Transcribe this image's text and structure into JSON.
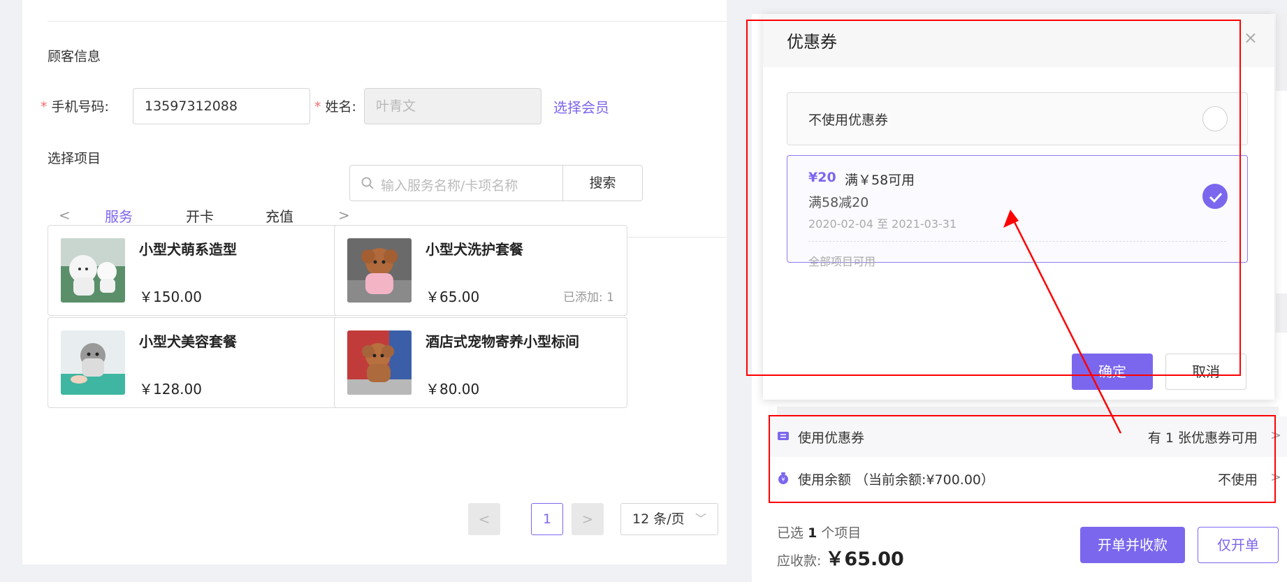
{
  "customer": {
    "section_title": "顾客信息",
    "phone_label": "手机号码:",
    "phone_value": "13597312088",
    "name_label": "姓名:",
    "name_placeholder": "叶青文",
    "select_member": "选择会员"
  },
  "project": {
    "section_title": "选择项目",
    "tab_prev": "<",
    "tab_next": ">",
    "tabs": [
      {
        "label": "服务",
        "active": true
      },
      {
        "label": "开卡",
        "active": false
      },
      {
        "label": "充值",
        "active": false
      }
    ],
    "search_placeholder": "输入服务名称/卡项名称",
    "search_button": "搜索",
    "items": [
      {
        "name": "小型犬萌系造型",
        "price": "￥150.00",
        "added": ""
      },
      {
        "name": "小型犬洗护套餐",
        "price": "￥65.00",
        "added": "已添加: 1"
      },
      {
        "name": "小型犬美容套餐",
        "price": "￥128.00",
        "added": ""
      },
      {
        "name": "酒店式宠物寄养小型标间",
        "price": "￥80.00",
        "added": ""
      }
    ]
  },
  "pagination": {
    "prev": "<",
    "current": "1",
    "next": ">",
    "page_size": "12 条/页"
  },
  "checkout": {
    "coupon_label": "使用优惠券",
    "coupon_value": "有 1 张优惠券可用",
    "balance_label": "使用余额 （当前余额:¥700.00）",
    "balance_value": "不使用",
    "chevron": ">",
    "selected_prefix": "已选",
    "selected_count": "1",
    "selected_suffix": "个项目",
    "due_label": "应收款:",
    "due_amount": "￥65.00",
    "primary_button": "开单并收款",
    "secondary_button": "仅开单"
  },
  "dialog": {
    "title": "优惠券",
    "close": "×",
    "no_coupon": "不使用优惠券",
    "coupon": {
      "amount": "¥20",
      "condition": "满￥58可用",
      "description": "满58减20",
      "dates": "2020-02-04 至 2021-03-31",
      "scope": "全部项目可用",
      "selected": true
    },
    "ok": "确定",
    "cancel": "取消"
  },
  "colors": {
    "accent": "#7b67ee",
    "required": "#f56c6c",
    "annotation": "#ff0000"
  }
}
